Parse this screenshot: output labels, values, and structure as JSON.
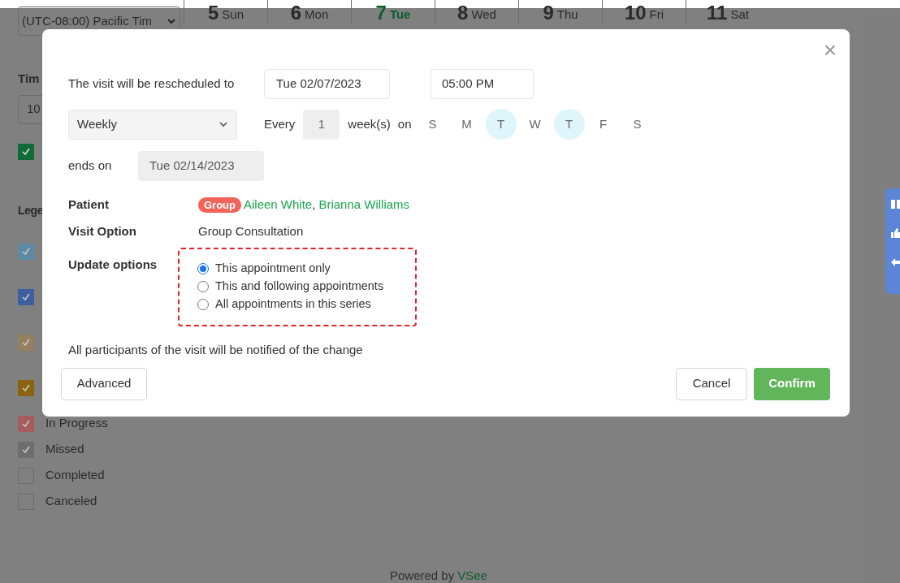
{
  "background": {
    "timezone": "(UTC-08:00) Pacific Tim",
    "days": [
      {
        "number": "5",
        "name": "Sun",
        "today": false
      },
      {
        "number": "6",
        "name": "Mon",
        "today": false
      },
      {
        "number": "7",
        "name": "Tue",
        "today": true
      },
      {
        "number": "8",
        "name": "Wed",
        "today": false
      },
      {
        "number": "9",
        "name": "Thu",
        "today": false
      },
      {
        "number": "10",
        "name": "Fri",
        "today": false
      },
      {
        "number": "11",
        "name": "Sat",
        "today": false
      }
    ],
    "time_label": "Tim",
    "time_value": "10",
    "legend_title": "Lege",
    "time_checkbox": {
      "checked": true
    },
    "legend": [
      {
        "checked": true,
        "color": "#5e8aa3"
      },
      {
        "checked": true,
        "color": "#3d5f9e"
      },
      {
        "checked": true,
        "color": "#94805e"
      },
      {
        "checked": true,
        "color": "#8c6410"
      },
      {
        "label": "In Progress",
        "checked": true,
        "color": "#a65c5c"
      },
      {
        "label": "Missed",
        "checked": true,
        "color": "#6e6e6e"
      },
      {
        "label": "Completed",
        "checked": false
      },
      {
        "label": "Canceled",
        "checked": false
      }
    ],
    "footer_prefix": "Powered by",
    "footer_brand": "VSee"
  },
  "dialog": {
    "close": "×",
    "reschedule_label": "The visit will be rescheduled to",
    "date": "Tue 02/07/2023",
    "time": "05:00 PM",
    "repeat": "Weekly",
    "every_label": "Every",
    "interval": "1",
    "unit_label": "week(s)",
    "on_label": "on",
    "weekdays": [
      {
        "label": "S",
        "selected": false
      },
      {
        "label": "M",
        "selected": false
      },
      {
        "label": "T",
        "selected": true
      },
      {
        "label": "W",
        "selected": false
      },
      {
        "label": "T",
        "selected": true
      },
      {
        "label": "F",
        "selected": false
      },
      {
        "label": "S",
        "selected": false
      }
    ],
    "ends_label": "ends on",
    "end_date": "Tue 02/14/2023",
    "patient_label": "Patient",
    "group_badge": "Group",
    "separator": ",",
    "patients": [
      "Aileen White",
      "Brianna Williams"
    ],
    "visit_option_label": "Visit Option",
    "visit_option": "Group Consultation",
    "update_label": "Update options",
    "update_options": [
      {
        "label": "This appointment only",
        "selected": true
      },
      {
        "label": "This and following appointments",
        "selected": false
      },
      {
        "label": "All appointments in this series",
        "selected": false
      }
    ],
    "notice": "All participants of the visit will be notified of the change",
    "advanced": "Advanced",
    "cancel": "Cancel",
    "confirm": "Confirm"
  }
}
